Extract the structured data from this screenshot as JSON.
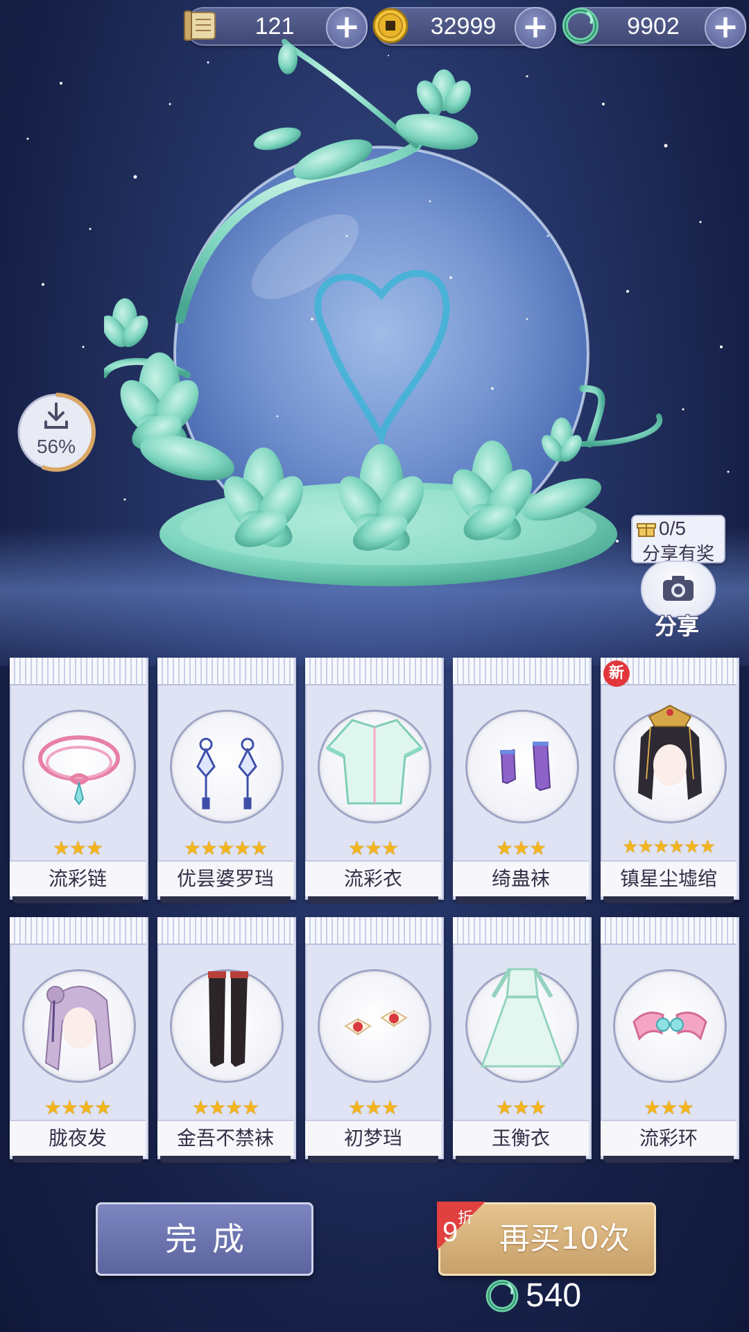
{
  "currencies": [
    {
      "icon": "scroll-icon",
      "value": "121"
    },
    {
      "icon": "gold-coin-icon",
      "value": "32999"
    },
    {
      "icon": "jade-dragon-icon",
      "value": "9902"
    }
  ],
  "download": {
    "percent_label": "56%",
    "progress": 0.56
  },
  "share": {
    "reward_count": "0/5",
    "reward_text": "分享有奖",
    "label": "分享"
  },
  "new_badge": "新",
  "items_row1": [
    {
      "name": "流彩链",
      "stars": "★★★"
    },
    {
      "name": "优昙婆罗珰",
      "stars": "★★★★★"
    },
    {
      "name": "流彩衣",
      "stars": "★★★"
    },
    {
      "name": "绮蛊袜",
      "stars": "★★★"
    },
    {
      "name": "镇星尘墟绾",
      "stars": "★★★★★★"
    }
  ],
  "items_row2": [
    {
      "name": "胧夜发",
      "stars": "★★★★"
    },
    {
      "name": "金吾不禁袜",
      "stars": "★★★★"
    },
    {
      "name": "初梦珰",
      "stars": "★★★"
    },
    {
      "name": "玉衡衣",
      "stars": "★★★"
    },
    {
      "name": "流彩环",
      "stars": "★★★"
    }
  ],
  "buttons": {
    "done": "完成",
    "buy_again": "再买10次",
    "discount_num": "9",
    "discount_unit": "折",
    "cost": "540"
  },
  "colors": {
    "accent_jade": "#7fd6c0",
    "gold_star": "#f3b41d",
    "buy_button": "#d6b07a",
    "done_button": "#6b73ae"
  }
}
